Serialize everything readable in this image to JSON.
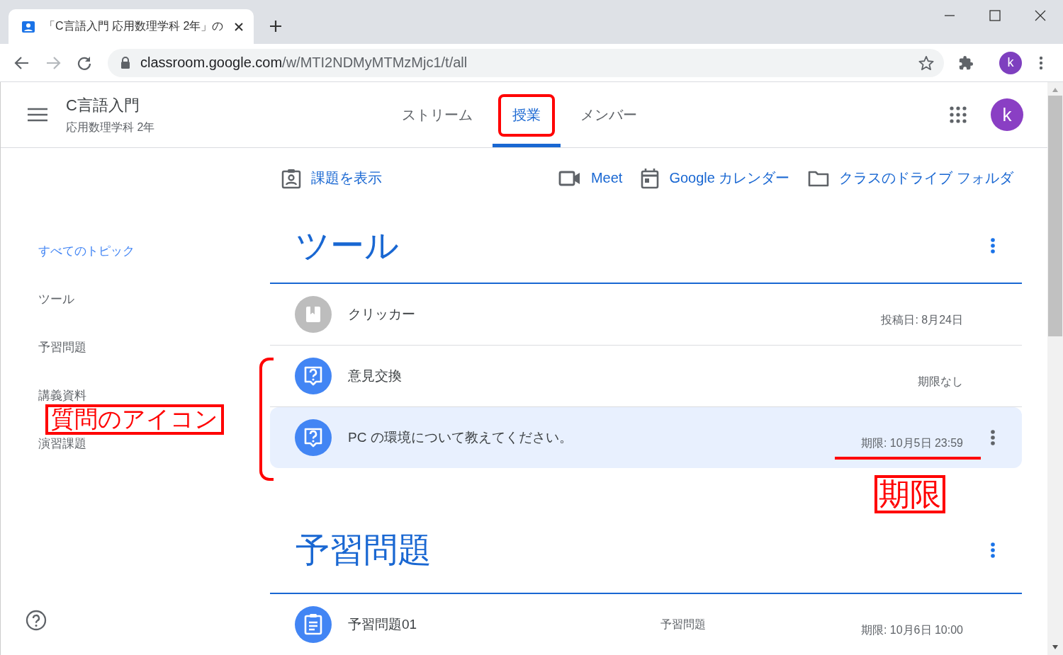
{
  "browser": {
    "tab_title": "「C言語入門 応用数理学科 2年」の",
    "url_host": "classroom.google.com",
    "url_path": "/w/MTI2NDMyMTMzMjc1/t/all",
    "profile_letter": "k"
  },
  "class": {
    "name": "C言語入門",
    "section": "応用数理学科 2年",
    "avatar_letter": "k"
  },
  "nav_tabs": [
    {
      "label": "ストリーム",
      "selected": false,
      "annotated": false
    },
    {
      "label": "授業",
      "selected": true,
      "annotated": true
    },
    {
      "label": "メンバー",
      "selected": false,
      "annotated": false
    }
  ],
  "toolbar": [
    {
      "kind": "assignments",
      "label": "課題を表示"
    },
    {
      "kind": "meet",
      "label": "Meet"
    },
    {
      "kind": "calendar",
      "label": "Google カレンダー"
    },
    {
      "kind": "drive",
      "label": "クラスのドライブ フォルダ"
    }
  ],
  "topics": [
    {
      "label": "すべてのトピック",
      "selected": true
    },
    {
      "label": "ツール",
      "selected": false
    },
    {
      "label": "予習問題",
      "selected": false
    },
    {
      "label": "講義資料",
      "selected": false
    },
    {
      "label": "演習課題",
      "selected": false
    }
  ],
  "sections": [
    {
      "title": "ツール",
      "items": [
        {
          "kind": "material",
          "title": "クリッカー",
          "meta": "投稿日: 8月24日",
          "hovered": false,
          "meta_annotated": false
        },
        {
          "kind": "question",
          "title": "意見交換",
          "meta": "期限なし",
          "hovered": false,
          "meta_annotated": false
        },
        {
          "kind": "question",
          "title": "PC の環境について教えてください。",
          "meta": "期限: 10月5日 23:59",
          "hovered": true,
          "meta_annotated": true
        }
      ]
    },
    {
      "title": "予習問題",
      "items": [
        {
          "kind": "assignment",
          "title": "予習問題01",
          "topic": "予習問題",
          "meta": "期限: 10月6日 10:00",
          "hovered": false,
          "meta_annotated": false
        }
      ]
    }
  ],
  "annotations": [
    {
      "kind": "icon-callout",
      "text": "質問のアイコン"
    },
    {
      "kind": "deadline-callout",
      "text": "期限"
    }
  ]
}
